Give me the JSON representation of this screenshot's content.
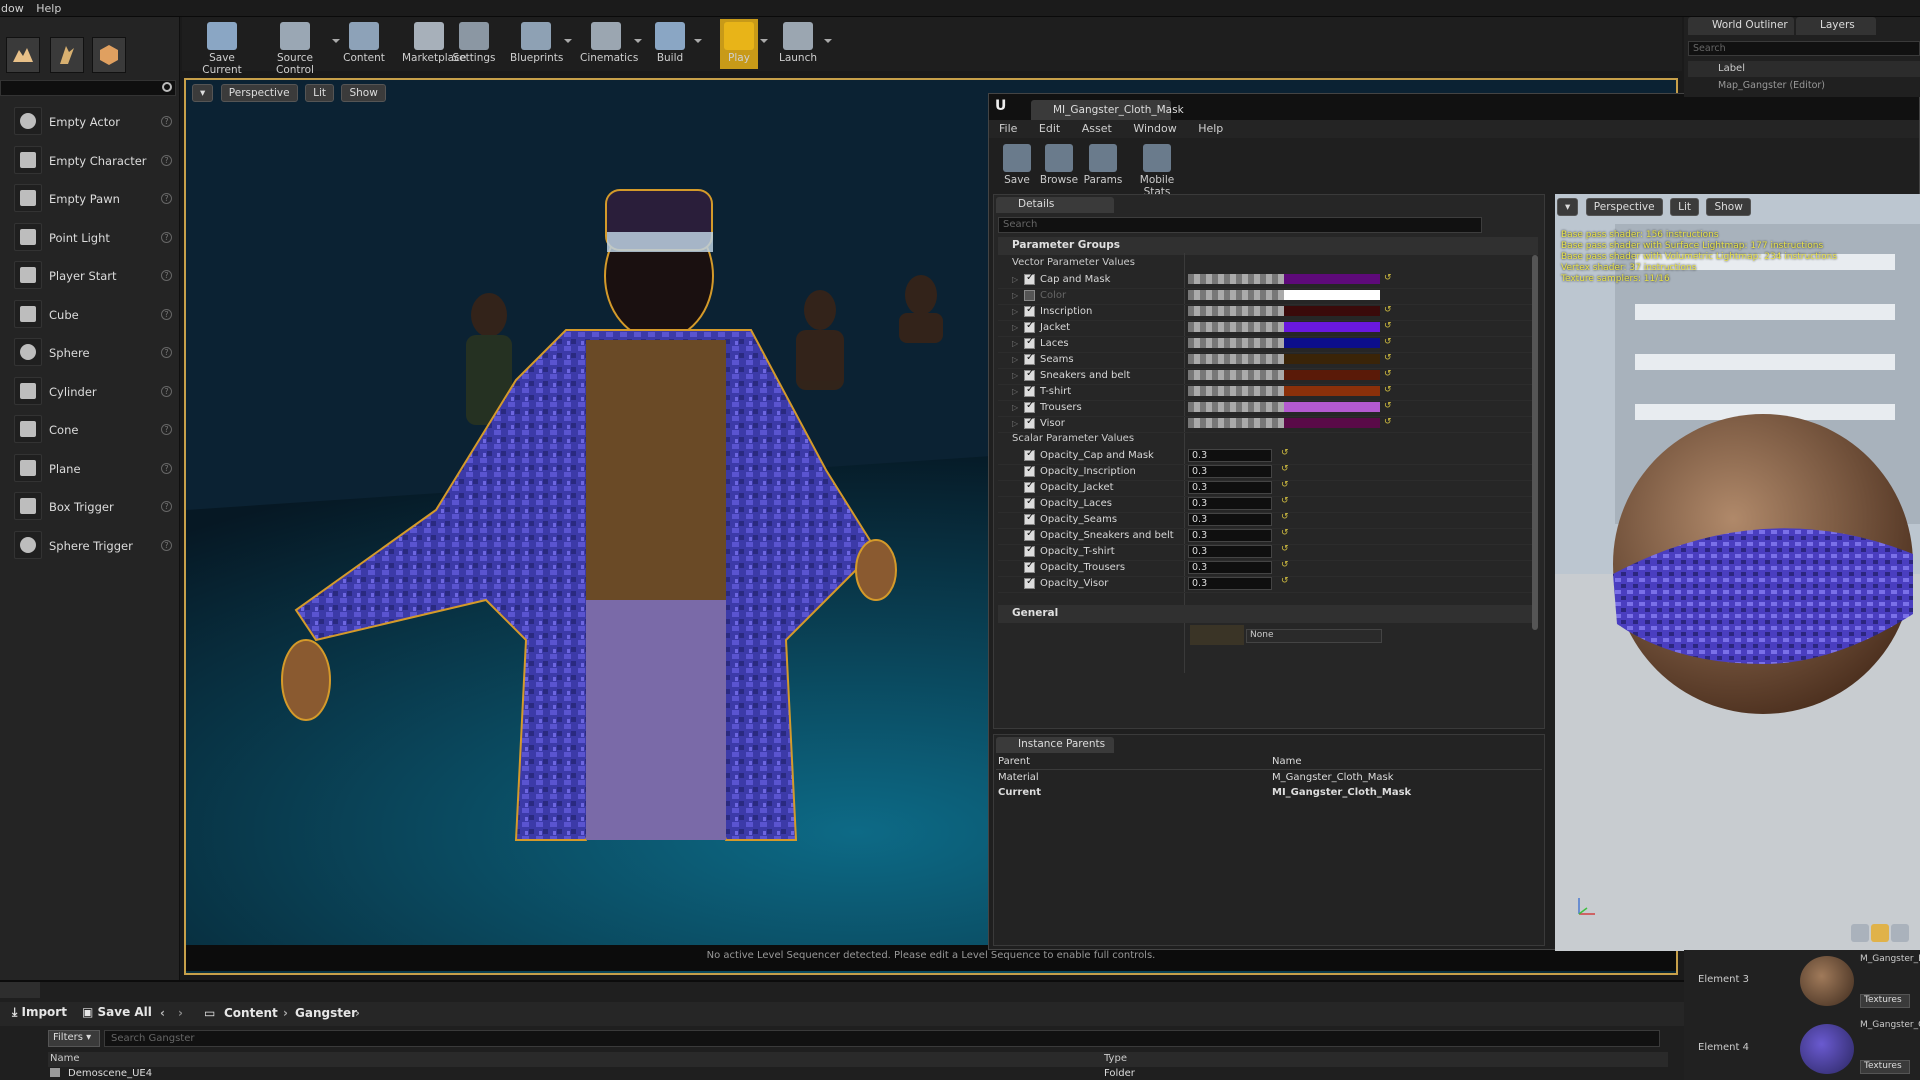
{
  "menubar": {
    "items": [
      "dow",
      "Help"
    ]
  },
  "place_panel": {
    "items": [
      {
        "label": "Empty Actor",
        "icon": "sphere-icon"
      },
      {
        "label": "Empty Character",
        "icon": "character-icon"
      },
      {
        "label": "Empty Pawn",
        "icon": "pawn-icon"
      },
      {
        "label": "Point Light",
        "icon": "light-bulb-icon"
      },
      {
        "label": "Player Start",
        "icon": "player-start-icon"
      },
      {
        "label": "Cube",
        "icon": "cube-icon"
      },
      {
        "label": "Sphere",
        "icon": "sphere-icon"
      },
      {
        "label": "Cylinder",
        "icon": "cylinder-icon"
      },
      {
        "label": "Cone",
        "icon": "cone-icon"
      },
      {
        "label": "Plane",
        "icon": "plane-icon"
      },
      {
        "label": "Box Trigger",
        "icon": "box-trigger-icon"
      },
      {
        "label": "Sphere Trigger",
        "icon": "sphere-trigger-icon"
      }
    ]
  },
  "toolbar": {
    "buttons": [
      {
        "label": "Save Current",
        "icon": "save-icon",
        "color": "#8aa6c4"
      },
      {
        "label": "Source Control",
        "icon": "source-control-icon",
        "color": "#9aa7b4"
      },
      {
        "label": "Content",
        "icon": "content-icon",
        "color": "#8da2b8"
      },
      {
        "label": "Marketplace",
        "icon": "marketplace-icon",
        "color": "#a7b0ba"
      },
      {
        "label": "Settings",
        "icon": "gear-icon",
        "color": "#8b97a3"
      },
      {
        "label": "Blueprints",
        "icon": "blueprints-icon",
        "color": "#8ea1b4"
      },
      {
        "label": "Cinematics",
        "icon": "clapper-icon",
        "color": "#9ba6b1"
      },
      {
        "label": "Build",
        "icon": "build-icon",
        "color": "#8aa6c4"
      },
      {
        "label": "Play",
        "icon": "play-icon",
        "color": "#e8b418"
      },
      {
        "label": "Launch",
        "icon": "launch-icon",
        "color": "#9ba6b1"
      }
    ]
  },
  "viewport": {
    "chips": [
      "Perspective",
      "Lit",
      "Show"
    ],
    "message": "No active Level Sequencer detected. Please edit a Level Sequence to enable full controls."
  },
  "material_editor": {
    "tab_title": "MI_Gangster_Cloth_Mask",
    "menu": [
      "File",
      "Edit",
      "Asset",
      "Window",
      "Help"
    ],
    "tools": [
      "Save",
      "Browse",
      "Params",
      "Mobile Stats"
    ],
    "details": {
      "tab": "Details",
      "search_placeholder": "Search",
      "section_title": "Parameter Groups",
      "vector_group": "Vector Parameter Values",
      "vector_params": [
        {
          "label": "Cap and Mask",
          "checked": true,
          "color": "#5e0a7a"
        },
        {
          "label": "Color",
          "checked": false,
          "color": "#ffffff"
        },
        {
          "label": "Inscription",
          "checked": true,
          "color": "#3a0a0a"
        },
        {
          "label": "Jacket",
          "checked": true,
          "color": "#6a18e0"
        },
        {
          "label": "Laces",
          "checked": true,
          "color": "#0c0e8c"
        },
        {
          "label": "Seams",
          "checked": true,
          "color": "#3a2408"
        },
        {
          "label": "Sneakers and belt",
          "checked": true,
          "color": "#5a1a08"
        },
        {
          "label": "T-shirt",
          "checked": true,
          "color": "#8a300a"
        },
        {
          "label": "Trousers",
          "checked": true,
          "color": "#b45ad0"
        },
        {
          "label": "Visor",
          "checked": true,
          "color": "#5a0a48"
        }
      ],
      "scalar_group": "Scalar Parameter Values",
      "scalar_params": [
        {
          "label": "Opacity_Cap and Mask",
          "value": "0.3"
        },
        {
          "label": "Opacity_Inscription",
          "value": "0.3"
        },
        {
          "label": "Opacity_Jacket",
          "value": "0.3"
        },
        {
          "label": "Opacity_Laces",
          "value": "0.3"
        },
        {
          "label": "Opacity_Seams",
          "value": "0.3"
        },
        {
          "label": "Opacity_Sneakers and belt",
          "value": "0.3"
        },
        {
          "label": "Opacity_T-shirt",
          "value": "0.3"
        },
        {
          "label": "Opacity_Trousers",
          "value": "0.3"
        },
        {
          "label": "Opacity_Visor",
          "value": "0.3"
        }
      ],
      "general_title": "General",
      "general_value": "None"
    },
    "instance_parents": {
      "tab": "Instance Parents",
      "headers": [
        "Parent",
        "Name"
      ],
      "rows": [
        {
          "parent": "Material",
          "name": "M_Gangster_Cloth_Mask"
        },
        {
          "parent": "Current",
          "name": "MI_Gangster_Cloth_Mask"
        }
      ]
    },
    "preview": {
      "chips": [
        "Perspective",
        "Lit",
        "Show"
      ],
      "stats": [
        "Base pass shader: 156 instructions",
        "Base pass shader with Surface Lightmap: 177 instructions",
        "Base pass shader with Volumetric Lightmap: 234 instructions",
        "Vertex shader: 37 instructions",
        "Texture samplers: 11/16"
      ]
    }
  },
  "outliner": {
    "tabs": [
      "World Outliner",
      "Layers"
    ],
    "search_placeholder": "Search",
    "header": "Label",
    "row": "Map_Gangster (Editor)"
  },
  "elements": [
    {
      "label": "Element 3",
      "thumb": "M_Gangster_B",
      "button": "Textures"
    },
    {
      "label": "Element 4",
      "thumb": "M_Gangster_C",
      "button": "Textures"
    }
  ],
  "content_browser": {
    "import": "Import",
    "save_all": "Save All",
    "crumbs": [
      "Content",
      "Gangster"
    ],
    "filters": "Filters",
    "search_placeholder": "Search Gangster",
    "headers": [
      "Name",
      "Type"
    ],
    "row": {
      "name": "Demoscene_UE4",
      "type": "Folder"
    }
  }
}
